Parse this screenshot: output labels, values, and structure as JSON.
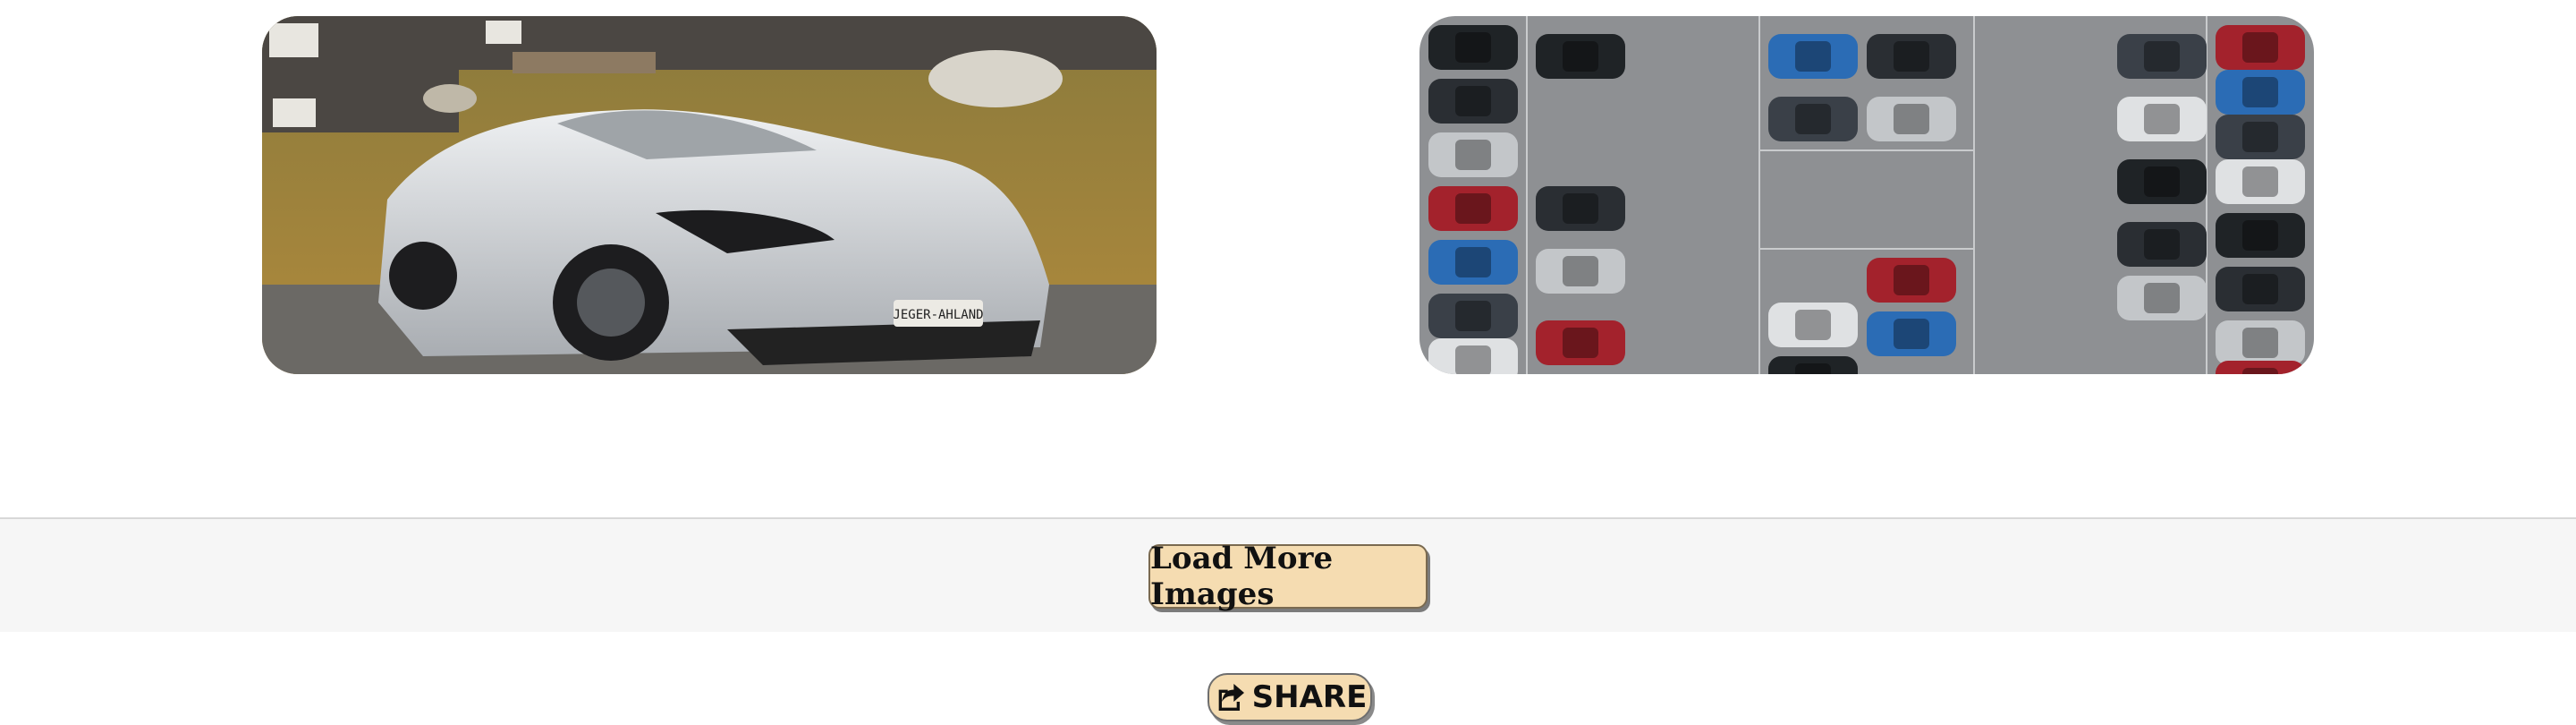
{
  "gallery": {
    "images": [
      {
        "name": "silver-sports-car",
        "plate_text": "JEGER-AHLAND"
      },
      {
        "name": "parking-lot-aerial"
      }
    ]
  },
  "actions": {
    "load_more_label": "Load More Images",
    "share_label": "SHARE",
    "share_icon": "share-icon"
  },
  "colors": {
    "button_bg": "#f5dcb1",
    "bar_bg": "#f6f6f6"
  }
}
